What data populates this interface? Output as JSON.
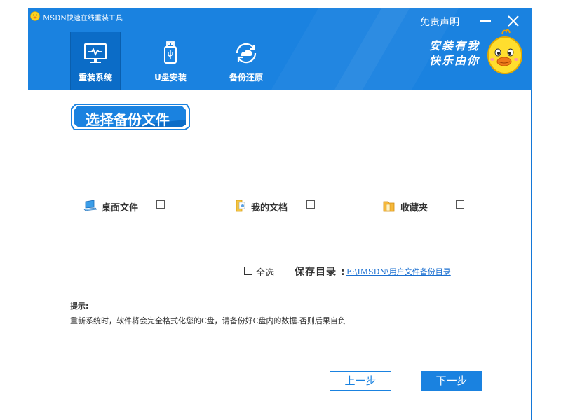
{
  "titlebar": {
    "app_title": "MSDN快速在线重装工具",
    "disclaimer": "免责声明",
    "minimize_icon": "minimize-icon",
    "close_icon": "close-icon"
  },
  "nav": {
    "items": [
      {
        "label": "重装系统",
        "icon": "monitor-icon",
        "active": true
      },
      {
        "label": "U盘安装",
        "icon": "usb-drive-icon",
        "active": false
      },
      {
        "label": "备份还原",
        "icon": "cloud-sync-icon",
        "active": false
      }
    ]
  },
  "slogan": {
    "line1": "安装有我",
    "line2": "快乐由你"
  },
  "page": {
    "heading": "选择备份文件"
  },
  "options": [
    {
      "label": "桌面文件",
      "icon": "desktop-icon",
      "checked": false
    },
    {
      "label": "我的文档",
      "icon": "documents-folder-icon",
      "checked": false
    },
    {
      "label": "收藏夹",
      "icon": "favorites-folder-icon",
      "checked": false
    }
  ],
  "select_all": {
    "label": "全选",
    "checked": false
  },
  "save_dir": {
    "label": "保存目录 :",
    "path": "E:\\IMSDN\\用户文件备份目录"
  },
  "hint": {
    "title": "提示:",
    "text": "重新系统时，软件将会完全格式化您的C盘，请备份好C盘内的数据.否则后果自负"
  },
  "buttons": {
    "prev": "上一步",
    "next": "下一步"
  },
  "colors": {
    "accent": "#1a82e0",
    "active_nav": "#0b6cc7",
    "link": "#1a6fd0"
  }
}
